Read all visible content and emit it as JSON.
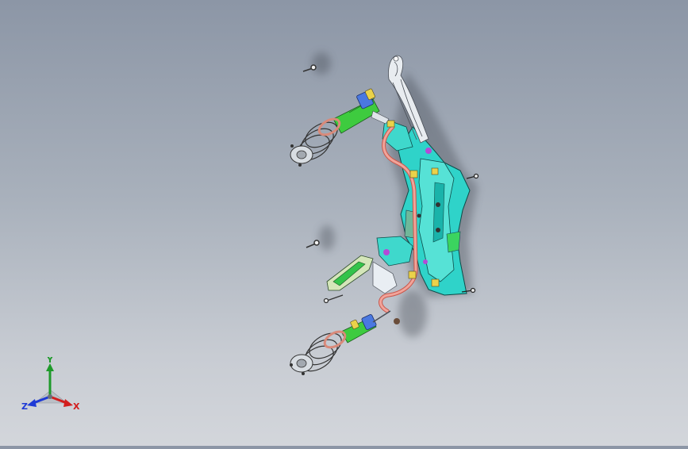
{
  "viewport": {
    "model": "suspension-assembly"
  },
  "triad": {
    "x_label": "X",
    "y_label": "Y",
    "z_label": "Z",
    "colors": {
      "x": "#d21e1e",
      "y": "#1e9a2a",
      "z": "#1e3ad6"
    }
  }
}
